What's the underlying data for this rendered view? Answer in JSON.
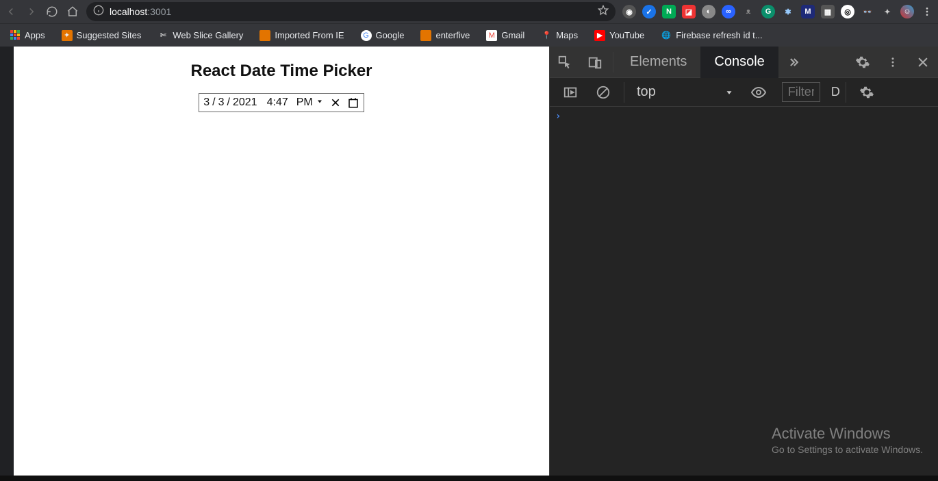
{
  "browser": {
    "url_host": "localhost",
    "url_port": ":3001"
  },
  "bookmarks": {
    "apps_label": "Apps",
    "items": [
      {
        "label": "Suggested Sites"
      },
      {
        "label": "Web Slice Gallery"
      },
      {
        "label": "Imported From IE"
      },
      {
        "label": "Google"
      },
      {
        "label": "enterfive"
      },
      {
        "label": "Gmail"
      },
      {
        "label": "Maps"
      },
      {
        "label": "YouTube"
      },
      {
        "label": "Firebase refresh id t..."
      }
    ]
  },
  "page": {
    "title": "React Date Time Picker",
    "datetime": {
      "month": "3",
      "day": "3",
      "year": "2021",
      "time": "4:47",
      "ampm": "PM"
    }
  },
  "devtools": {
    "tabs": {
      "elements": "Elements",
      "console": "Console"
    },
    "console_toolbar": {
      "context": "top",
      "filter_placeholder": "Filter",
      "level_letter": "D"
    }
  },
  "windows": {
    "activate_title": "Activate Windows",
    "activate_sub": "Go to Settings to activate Windows."
  }
}
